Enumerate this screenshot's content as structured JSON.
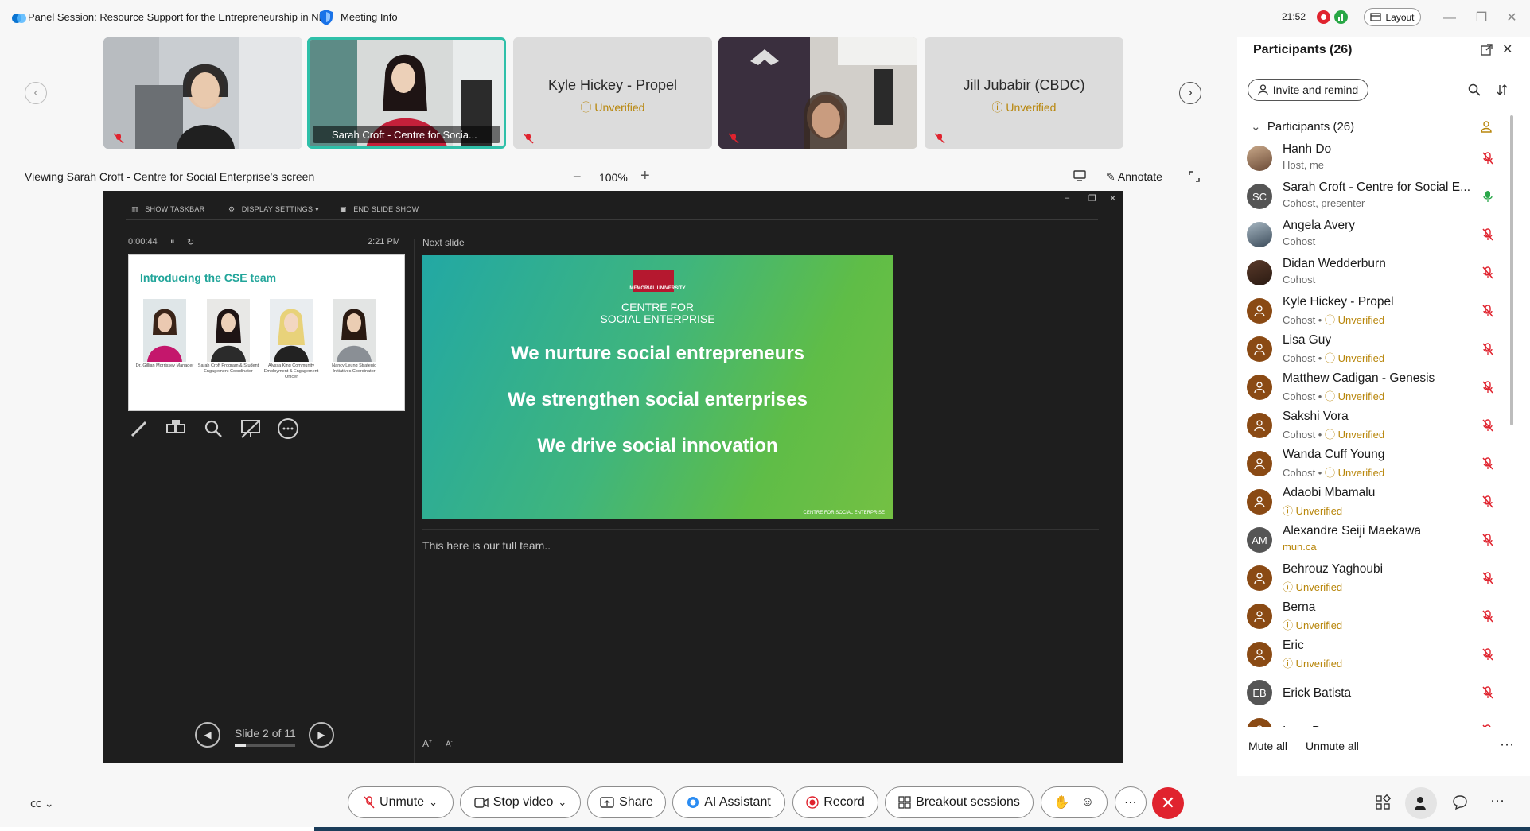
{
  "title_bar": {
    "meeting_title": "Panel Session: Resource Support for the Entrepreneurship in NL",
    "meeting_info": "Meeting Info",
    "time": "21:52",
    "layout_label": "Layout"
  },
  "thumbnails": [
    {
      "name": "",
      "type": "video"
    },
    {
      "name": "Sarah Croft - Centre for Socia...",
      "type": "video"
    },
    {
      "name": "Kyle Hickey - Propel",
      "status": "Unverified",
      "type": "placeholder"
    },
    {
      "name": "",
      "type": "video"
    },
    {
      "name": "Jill Jubabir (CBDC)",
      "status": "Unverified",
      "type": "placeholder"
    }
  ],
  "viewing": {
    "label": "Viewing Sarah Croft - Centre for Social Enterprise's screen",
    "zoom": "100%",
    "annotate": "Annotate"
  },
  "presenter_view": {
    "toolbar": {
      "show_taskbar": "SHOW TASKBAR",
      "display_settings": "DISPLAY SETTINGS ▾",
      "end_slide_show": "END SLIDE SHOW"
    },
    "timer": "0:00:44",
    "clock": "2:21 PM",
    "next_slide_label": "Next slide",
    "current_slide": {
      "heading": "Introducing the CSE team",
      "members": [
        {
          "caption": "Dr. Gillian Morrissey Manager"
        },
        {
          "caption": "Sarah Croft Program & Student Engagement Coordinator"
        },
        {
          "caption": "Alyssa King Community Employment & Engagement Officer"
        },
        {
          "caption": "Nancy Leung Strategic Initiatives Coordinator"
        }
      ]
    },
    "next_slide": {
      "org_small": "MEMORIAL UNIVERSITY",
      "org_line1": "CENTRE FOR",
      "org_line2": "SOCIAL ENTERPRISE",
      "line1": "We nurture social entrepreneurs",
      "line2": "We strengthen social enterprises",
      "line3": "We drive social innovation",
      "footer": "CENTRE FOR SOCIAL ENTERPRISE"
    },
    "notes": "This here is our full team..",
    "slide_counter": "Slide 2 of 11",
    "progress": 0.18
  },
  "participants_panel": {
    "title": "Participants (26)",
    "invite_label": "Invite and remind",
    "group_label": "Participants (26)",
    "participants": [
      {
        "name": "Hanh Do",
        "role": "Host, me",
        "avatar": "photo",
        "initials": "",
        "unverified": false
      },
      {
        "name": "Sarah Croft - Centre for Social E...",
        "role": "Cohost, presenter",
        "avatar": "grey",
        "initials": "SC",
        "unverified": false
      },
      {
        "name": "Angela Avery",
        "role": "Cohost",
        "avatar": "photo2",
        "initials": "",
        "unverified": false
      },
      {
        "name": "Didan Wedderburn",
        "role": "Cohost",
        "avatar": "photo3",
        "initials": "",
        "unverified": false
      },
      {
        "name": "Kyle Hickey - Propel",
        "role": "Cohost •",
        "avatar": "orange",
        "initials": "",
        "unverified": true
      },
      {
        "name": "Lisa Guy",
        "role": "Cohost •",
        "avatar": "orange",
        "initials": "",
        "unverified": true
      },
      {
        "name": "Matthew Cadigan - Genesis",
        "role": "Cohost •",
        "avatar": "orange",
        "initials": "",
        "unverified": true
      },
      {
        "name": "Sakshi Vora",
        "role": "Cohost •",
        "avatar": "orange",
        "initials": "",
        "unverified": true
      },
      {
        "name": "Wanda Cuff Young",
        "role": "Cohost •",
        "avatar": "orange",
        "initials": "",
        "unverified": true
      },
      {
        "name": "Adaobi Mbamalu",
        "role": "",
        "avatar": "orange",
        "initials": "",
        "unverified": true
      },
      {
        "name": "Alexandre Seiji Maekawa",
        "role": "mun.ca",
        "avatar": "grey",
        "initials": "AM",
        "unverified": false
      },
      {
        "name": "Behrouz Yaghoubi",
        "role": "",
        "avatar": "orange",
        "initials": "",
        "unverified": true
      },
      {
        "name": "Berna",
        "role": "",
        "avatar": "orange",
        "initials": "",
        "unverified": true
      },
      {
        "name": "Eric",
        "role": "",
        "avatar": "orange",
        "initials": "",
        "unverified": true
      },
      {
        "name": "Erick Batista",
        "role": "",
        "avatar": "grey",
        "initials": "EB",
        "unverified": false
      },
      {
        "name": "Iqwe Peace",
        "role": "",
        "avatar": "orange",
        "initials": "",
        "unverified": false
      }
    ],
    "unverified_label": "Unverified",
    "mute_all": "Mute all",
    "unmute_all": "Unmute all"
  },
  "bottom_bar": {
    "unmute": "Unmute",
    "stop_video": "Stop video",
    "share": "Share",
    "ai_assistant": "AI Assistant",
    "record": "Record",
    "breakout": "Breakout sessions"
  },
  "colors": {
    "accent_teal": "#2fc0a9",
    "unverified": "#b8860b",
    "mute_red": "#e0232e",
    "slide_green": "#5fbd47"
  }
}
